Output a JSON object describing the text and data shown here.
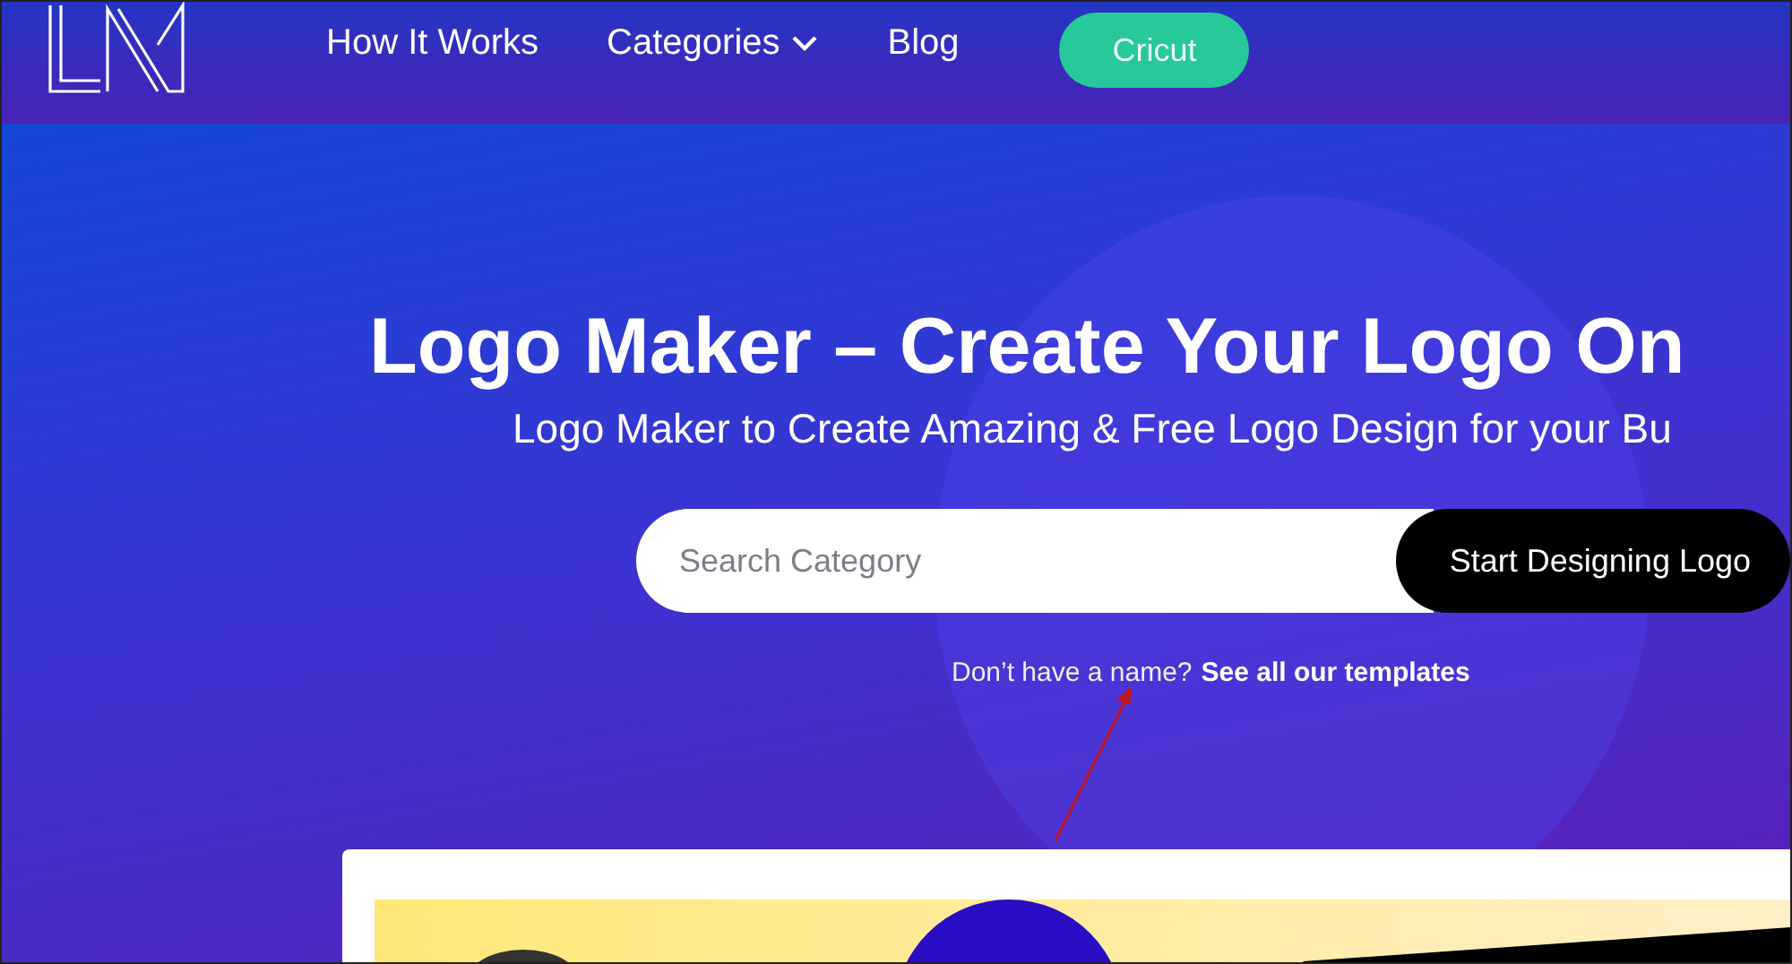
{
  "header": {
    "nav": [
      {
        "label": "How It Works",
        "kind": "link"
      },
      {
        "label": "Categories",
        "kind": "dropdown"
      },
      {
        "label": "Blog",
        "kind": "link"
      }
    ],
    "cta": "Cricut"
  },
  "hero": {
    "title": "Logo Maker – Create Your Logo On",
    "subtitle": "Logo Maker to Create Amazing & Free Logo Design for your Bu",
    "search": {
      "placeholder": "Search Category"
    },
    "button": "Start Designing Logo",
    "helper": {
      "text": "Don’t have a name?",
      "link": "See all our templates"
    }
  }
}
